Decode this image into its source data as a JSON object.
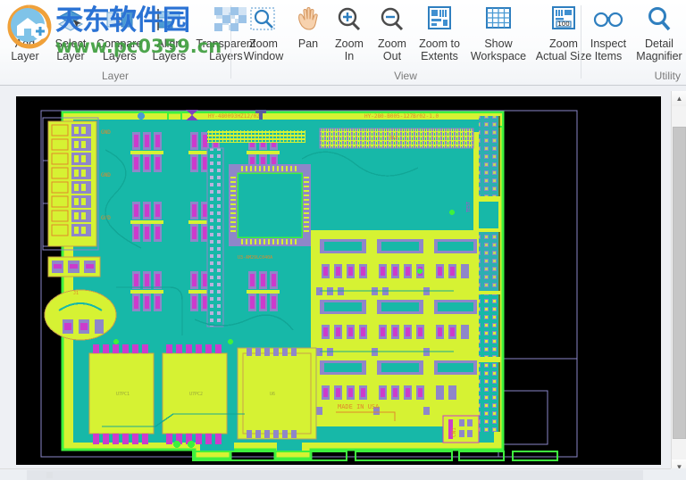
{
  "watermark": {
    "cn_text": "天东软件园",
    "url": "www.pc0359.cn",
    "logo_icon": "circular-home-plus-logo",
    "checker_icon": "checkerboard-icon"
  },
  "ribbon": {
    "groups": [
      {
        "name": "layer",
        "label": "Layer",
        "buttons": [
          {
            "id": "add-layer",
            "label": "Add\nLayer",
            "icon": "add-layer-icon",
            "has_dropdown": true
          },
          {
            "id": "select-layer",
            "label": "Select\nLayer",
            "icon": "select-layer-icon",
            "has_dropdown": false
          },
          {
            "id": "compare-layers",
            "label": "Compare\nLayers",
            "icon": "compare-layers-icon",
            "has_dropdown": false
          },
          {
            "id": "align-layers",
            "label": "Align\nLayers",
            "icon": "align-layers-icon",
            "has_dropdown": false
          },
          {
            "id": "transparent-layers",
            "label": "Transparent\nLayers",
            "icon": "transparent-layers-icon",
            "has_dropdown": false
          }
        ]
      },
      {
        "name": "view",
        "label": "View",
        "buttons": [
          {
            "id": "zoom-window",
            "label": "Zoom\nWindow",
            "icon": "zoom-window-icon",
            "has_dropdown": false
          },
          {
            "id": "pan",
            "label": "Pan",
            "icon": "pan-hand-icon",
            "has_dropdown": false
          },
          {
            "id": "zoom-in",
            "label": "Zoom\nIn",
            "icon": "zoom-in-icon",
            "has_dropdown": false
          },
          {
            "id": "zoom-out",
            "label": "Zoom\nOut",
            "icon": "zoom-out-icon",
            "has_dropdown": false
          },
          {
            "id": "zoom-to-extents",
            "label": "Zoom to\nExtents",
            "icon": "zoom-extents-icon",
            "has_dropdown": false
          },
          {
            "id": "show-workspace",
            "label": "Show\nWorkspace",
            "icon": "grid-workspace-icon",
            "has_dropdown": false
          },
          {
            "id": "zoom-actual-size",
            "label": "Zoom\nActual Size",
            "icon": "zoom-actual-size-icon",
            "has_dropdown": false,
            "badge": "100"
          }
        ]
      },
      {
        "name": "utility",
        "label": "Utility",
        "buttons": [
          {
            "id": "inspect-items",
            "label": "Inspect\nItems",
            "icon": "glasses-icon",
            "has_dropdown": false
          },
          {
            "id": "detail-magnifier",
            "label": "Detail\nMagnifier",
            "icon": "magnifier-icon",
            "has_dropdown": false
          }
        ]
      }
    ]
  },
  "canvas": {
    "name": "pcb-viewer-canvas",
    "background": "#000000",
    "board_silk_texts": [
      "HY-480093HZ12/02",
      "HY-280-B005-127Br02-1.0",
      "MADE IN USA",
      "GND",
      "CN1"
    ],
    "colors": {
      "board_fill": "#17b8a8",
      "copper_pour": "#d6f233",
      "pad_purple": "#7f74c4",
      "pad_magenta": "#cc3bcc",
      "silk_orange": "#e08a2a",
      "outline_green": "#3ef03e",
      "selection_box": "#8a86c8",
      "trace_teal": "#11a596"
    }
  },
  "scrollbars": {
    "vertical": {
      "name": "vertical-scrollbar",
      "up_glyph": "▲",
      "down_glyph": "▼"
    },
    "horizontal": {
      "name": "horizontal-scrollbar"
    }
  }
}
